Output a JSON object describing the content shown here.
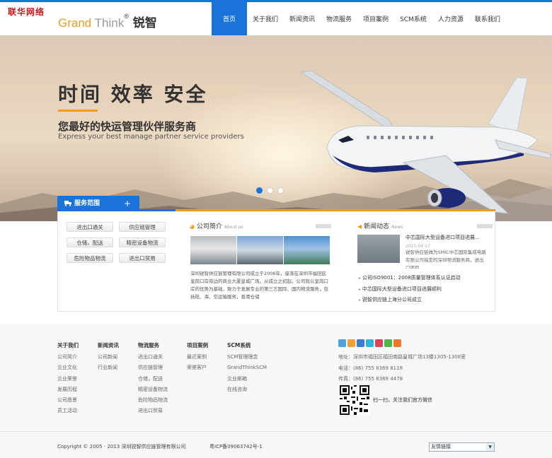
{
  "watermark": "联华网络",
  "logo": {
    "part1": "Grand",
    "part2": " Think",
    "reg": "®",
    "cn": " 锐智"
  },
  "nav": [
    "首页",
    "关于我们",
    "新闻资讯",
    "物流服务",
    "项目案例",
    "SCM系统",
    "人力资源",
    "联系我们"
  ],
  "banner": {
    "title": "时间 效率 安全",
    "subtitle": "您最好的快运管理伙伴服务商",
    "subtitle_en": "Express your best manage partner service providers"
  },
  "services": {
    "tab_label": "服务范围",
    "plus": "+",
    "items": [
      "进出口通关",
      "供应链管理",
      "仓储，配送",
      "精密设备物流",
      "危险物品物流",
      "进出口贸易"
    ]
  },
  "about": {
    "title": "公司简介",
    "title_en": "About us",
    "text": "深圳锐智供应链管理有限公司成立于2006年，座落在深圳市福田区皇岗口岸旁边的商业大厦皇城广场。从成立之初起，公司就以皇岗口岸的优势为基础，致力于发展专业的第三方国际、国内物流服务，包括陆、海、空运输服务，香港仓储"
  },
  "news": {
    "title": "新闻动态",
    "title_en": "News",
    "featured_title": "中芯国际大型设备进口项目进展…",
    "featured_date": "2015-04-17",
    "featured_desc": "锐智供应链做为SMIC中芯国际集成电路有限公司指定的深圳物流服务商，进出口项目",
    "list": [
      "公司ISO9001：2008质量管理体系认证启动",
      "中芯国际大型设备进口项目进展顺利",
      "锐智供应链上海分公司成立"
    ]
  },
  "footer": {
    "columns": [
      {
        "head": "关于我们",
        "items": [
          "公司简介",
          "企业文化",
          "企业荣誉",
          "发展历程",
          "公司愿景",
          "员工活动"
        ]
      },
      {
        "head": "新闻资讯",
        "items": [
          "公司新闻",
          "行业新闻"
        ]
      },
      {
        "head": "物流服务",
        "items": [
          "进出口通关",
          "供应链管理",
          "仓储，配送",
          "精密设备物流",
          "危险物品物流",
          "进出口贸易"
        ]
      },
      {
        "head": "项目案例",
        "items": [
          "最近案例",
          "荣誉客户"
        ]
      },
      {
        "head": "SCM系统",
        "items": [
          "SCM管理理念",
          "GrandThinkSCM",
          "企业邮箱",
          "在线咨询"
        ]
      }
    ],
    "address": "地址：深圳市福田区福田南路皇城广场13楼1305-1308室",
    "phone": "电话：(86) 755 8369 8118",
    "fax": "传真：(86) 755 8369 4478",
    "qr_text": "扫一扫，关注我们官方微信",
    "copyright": "Copyright © 2005 - 2013 深圳锐智供应链管理有限公司",
    "icp": "粤ICP备09063742号-1",
    "links_select": "友情链接",
    "social_colors": [
      "#4aa3df",
      "#f0a030",
      "#3b7bd4",
      "#31b3e0",
      "#e0405a",
      "#4cb848",
      "#f0762a"
    ]
  }
}
